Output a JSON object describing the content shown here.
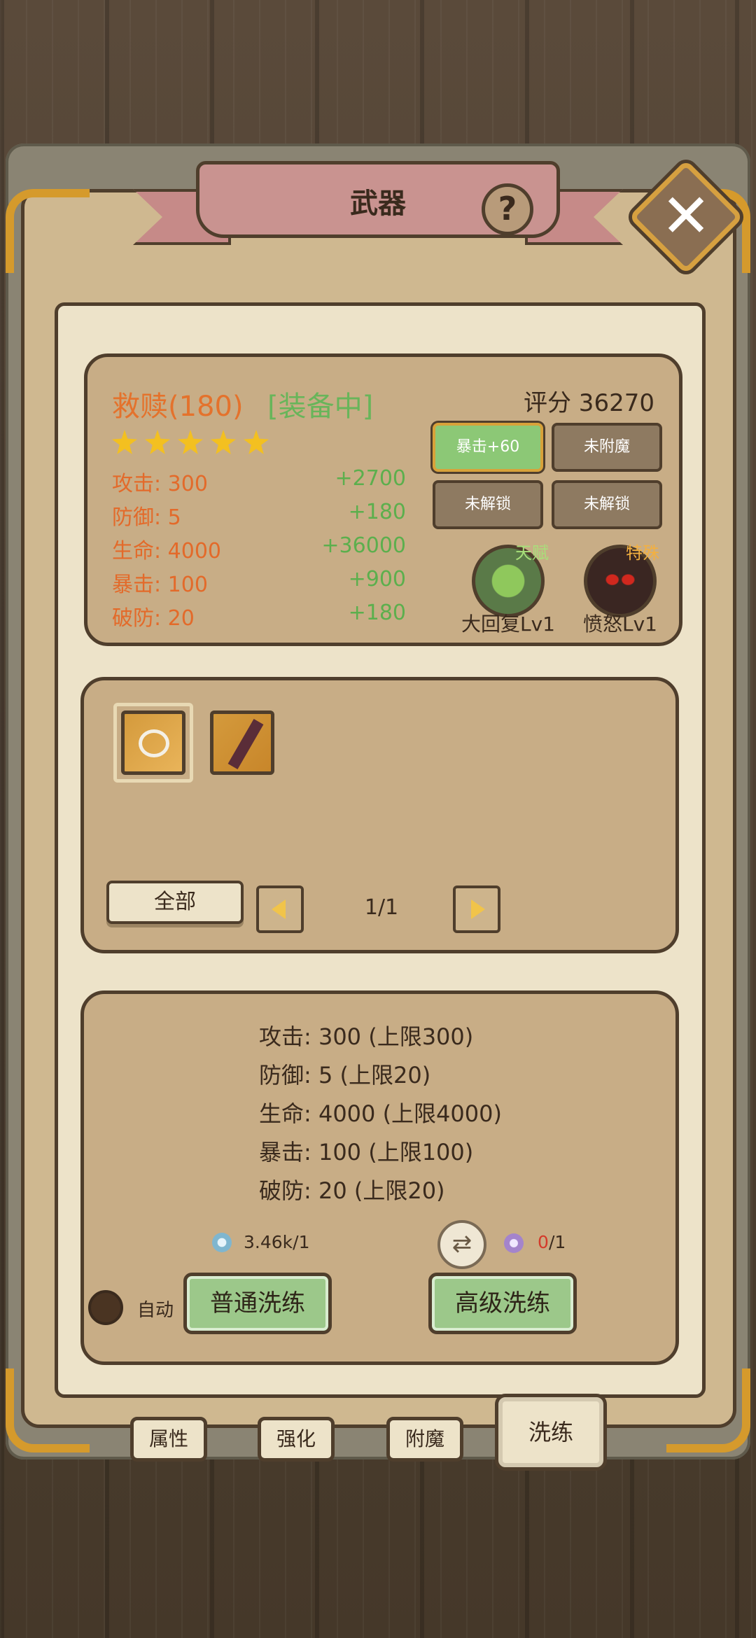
{
  "title": "武器",
  "help_label": "?",
  "close_label": "✕",
  "item": {
    "name": "救赎(180)",
    "status": "[装备中]",
    "score": "评分 36270",
    "stars": 5,
    "stats": [
      {
        "label": "攻击: 300",
        "bonus": "+2700"
      },
      {
        "label": "防御: 5",
        "bonus": "+180"
      },
      {
        "label": "生命: 4000",
        "bonus": "+36000"
      },
      {
        "label": "暴击: 100",
        "bonus": "+900"
      },
      {
        "label": "破防: 20",
        "bonus": "+180"
      }
    ]
  },
  "enchant_slots": [
    "暴击+60",
    "未附魔",
    "未解锁",
    "未解锁"
  ],
  "skills": [
    {
      "tag": "天赋",
      "name": "大回复Lv1",
      "tag_color": "#a8e07a"
    },
    {
      "tag": "特殊",
      "name": "愤怒Lv1",
      "tag_color": "#f3b040"
    }
  ],
  "inventory": {
    "filter_label": "全部",
    "page": "1/1"
  },
  "reforge": {
    "limits": [
      "攻击: 300 (上限300)",
      "防御: 5 (上限20)",
      "生命: 4000 (上限4000)",
      "暴击: 100 (上限100)",
      "破防: 20 (上限20)"
    ],
    "cost_basic": "3.46k/1",
    "cost_adv_have": "0",
    "cost_adv_need": "/1",
    "auto_label": "自动",
    "basic_button": "普通洗练",
    "advanced_button": "高级洗练"
  },
  "tabs": [
    "属性",
    "强化",
    "附魔",
    "洗练"
  ],
  "colors": {
    "accent_orange": "#e4722c",
    "accent_green": "#5caf4d",
    "alert_red": "#d43a2a"
  }
}
